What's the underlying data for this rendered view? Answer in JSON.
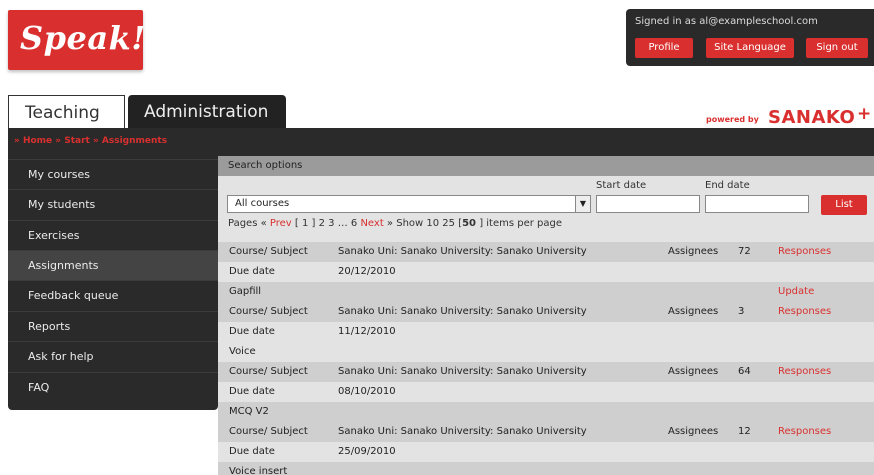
{
  "logo": {
    "text": "Speak!"
  },
  "account": {
    "signed_in": "Signed in as al@exampleschool.com",
    "profile": "Profile",
    "site_language": "Site Language",
    "sign_out": "Sign out"
  },
  "powered": {
    "label": "powered by",
    "brand": "SANAKO",
    "mark": "+"
  },
  "tabs": {
    "teaching": "Teaching",
    "administration": "Administration"
  },
  "breadcrumb": "» Home » Start » Assignments",
  "sidebar": {
    "items": [
      {
        "label": "My courses"
      },
      {
        "label": "My students"
      },
      {
        "label": "Exercises"
      },
      {
        "label": "Assignments"
      },
      {
        "label": "Feedback queue"
      },
      {
        "label": "Reports"
      },
      {
        "label": "Ask for help"
      },
      {
        "label": "FAQ"
      }
    ],
    "active_index": 3
  },
  "search": {
    "header": "Search options",
    "start_date_label": "Start date",
    "end_date_label": "End date",
    "course_select": "All courses",
    "list_button": "List"
  },
  "pager": {
    "pages_label": "Pages «",
    "prev": "Prev",
    "pages_mid": "[ 1 ]  2  3  …  6",
    "next": "Next",
    "show_label": "»   Show 10 25 [",
    "show_selected": "50",
    "show_suffix": "] items per page"
  },
  "assignments": [
    {
      "course_label": "Course/ Subject",
      "course": "Sanako Uni: Sanako University: Sanako University",
      "assignees_label": "Assignees",
      "assignees": "72",
      "responses": "Responses",
      "due_label": "Due date",
      "due": "20/12/2010",
      "name": "Gapfill",
      "update": "Update"
    },
    {
      "course_label": "Course/ Subject",
      "course": "Sanako Uni: Sanako University: Sanako University",
      "assignees_label": "Assignees",
      "assignees": "3",
      "responses": "Responses",
      "due_label": "Due date",
      "due": "11/12/2010",
      "name": "Voice",
      "update": ""
    },
    {
      "course_label": "Course/ Subject",
      "course": "Sanako Uni: Sanako University: Sanako University",
      "assignees_label": "Assignees",
      "assignees": "64",
      "responses": "Responses",
      "due_label": "Due date",
      "due": "08/10/2010",
      "name": "MCQ V2",
      "update": ""
    },
    {
      "course_label": "Course/ Subject",
      "course": "Sanako Uni: Sanako University: Sanako University",
      "assignees_label": "Assignees",
      "assignees": "12",
      "responses": "Responses",
      "due_label": "Due date",
      "due": "25/09/2010",
      "name": "Voice insert",
      "update": ""
    }
  ]
}
